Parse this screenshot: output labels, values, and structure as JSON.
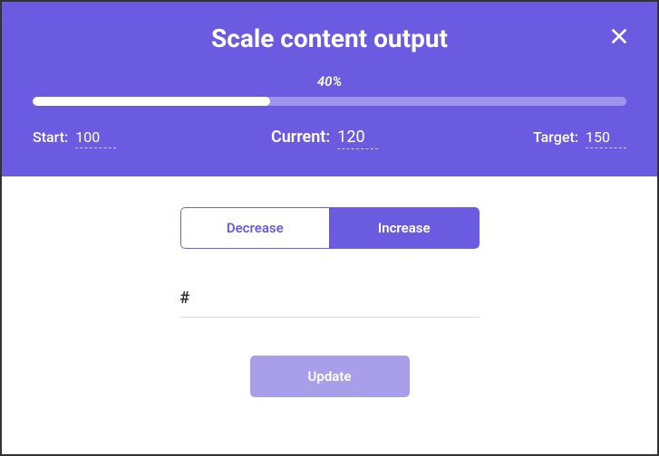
{
  "title": "Scale content output",
  "progress": {
    "percent_label": "40%",
    "percent_value": 40
  },
  "stats": {
    "start_label": "Start:",
    "start_value": "100",
    "current_label": "Current:",
    "current_value": "120",
    "target_label": "Target:",
    "target_value": "150"
  },
  "toggle": {
    "decrease": "Decrease",
    "increase": "Increase",
    "active": "increase"
  },
  "amount": {
    "prefix": "#",
    "value": ""
  },
  "buttons": {
    "update": "Update"
  }
}
